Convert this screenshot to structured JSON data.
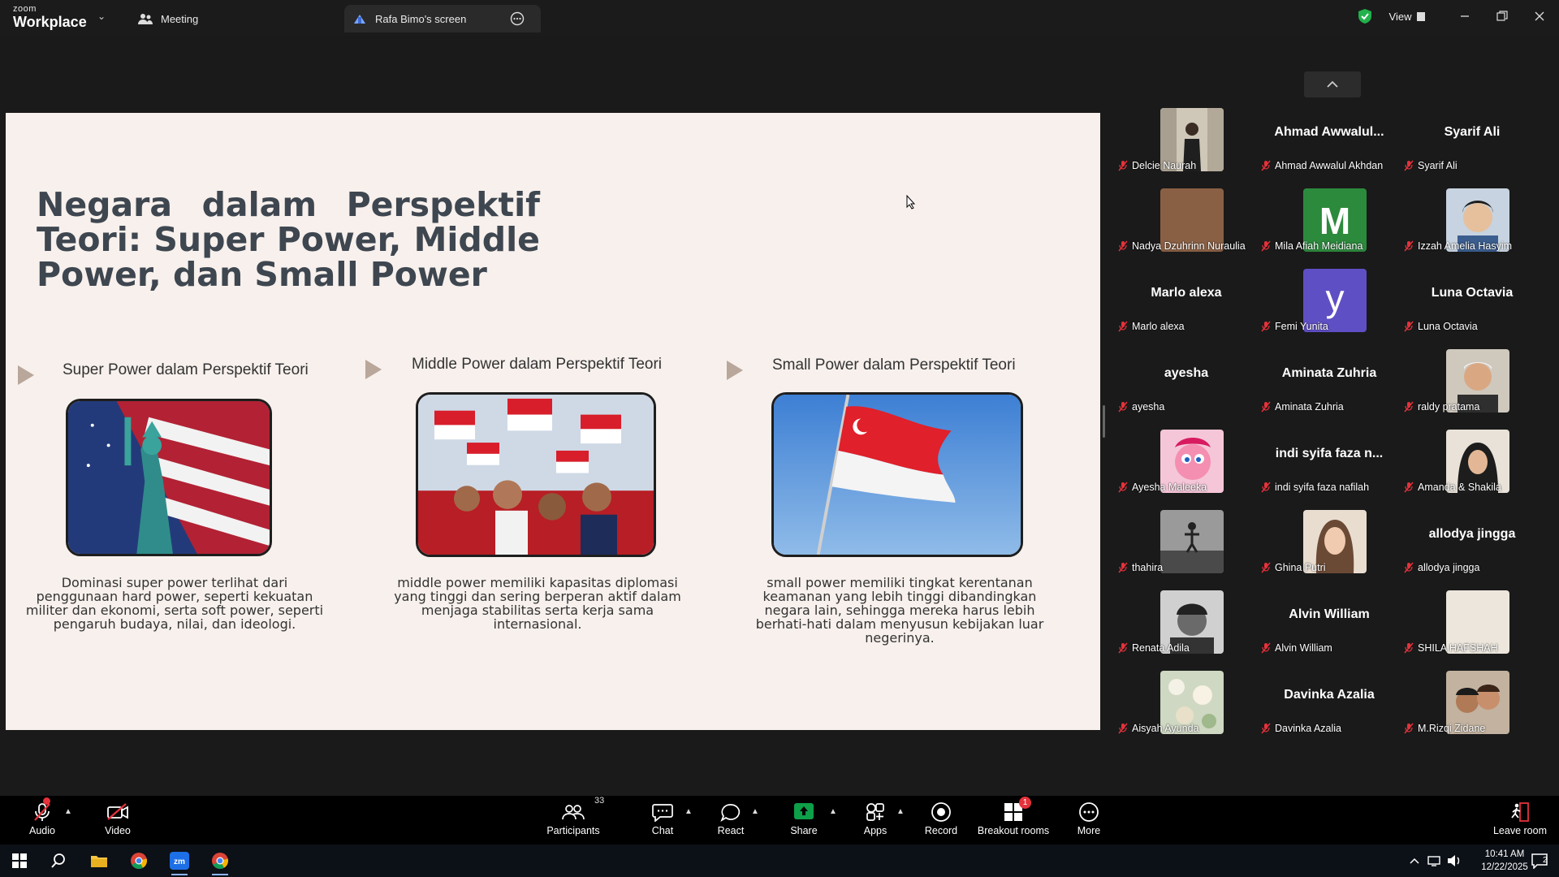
{
  "app": {
    "brand_small": "zoom",
    "brand_large": "Workplace"
  },
  "tabs": {
    "meeting": "Meeting",
    "screen": "Rafa Bimo's screen"
  },
  "view_label": "View",
  "slide": {
    "title": "Negara dalam Perspektif Teori: Super Power, Middle Power, dan Small Power",
    "columns": [
      {
        "heading": "Super Power dalam Perspektif Teori",
        "text": "Dominasi super power terlihat dari penggunaan hard power, seperti kekuatan militer dan ekonomi, serta soft power, seperti pengaruh budaya, nilai, dan ideologi."
      },
      {
        "heading": "Middle Power dalam Perspektif Teori",
        "text": "middle power memiliki kapasitas diplomasi yang tinggi dan sering berperan aktif dalam menjaga stabilitas serta kerja sama internasional."
      },
      {
        "heading": "Small Power dalam Perspektif Teori",
        "text": "small power memiliki tingkat kerentanan keamanan yang lebih tinggi dibandingkan negara lain, sehingga mereka harus lebih berhati-hati dalam menyusun kebijakan luar negerinya."
      }
    ]
  },
  "participants_gallery": [
    [
      {
        "name": "Delcie Naurah",
        "display": "",
        "avatar": "photo-suit"
      },
      {
        "name": "Ahmad Awwalul Akhdan",
        "display": "Ahmad Awwalul...",
        "avatar": ""
      },
      {
        "name": "Syarif Ali",
        "display": "Syarif Ali",
        "avatar": ""
      }
    ],
    [
      {
        "name": "Nadya Dzuhrinn Nuraulia",
        "display": "",
        "avatar": "brown-tile"
      },
      {
        "name": "Mila Afiah Meidiana",
        "display": "",
        "avatar": "letter-M"
      },
      {
        "name": "Izzah Amelia Hasyim",
        "display": "",
        "avatar": "photo-child"
      }
    ],
    [
      {
        "name": "Marlo alexa",
        "display": "Marlo alexa",
        "avatar": ""
      },
      {
        "name": "Femi Yunita",
        "display": "",
        "avatar": "letter-y"
      },
      {
        "name": "Luna Octavia",
        "display": "Luna Octavia",
        "avatar": ""
      }
    ],
    [
      {
        "name": "ayesha",
        "display": "ayesha",
        "avatar": ""
      },
      {
        "name": "Aminata Zuhria",
        "display": "Aminata Zuhria",
        "avatar": ""
      },
      {
        "name": "raldy pratama",
        "display": "",
        "avatar": "photo-man"
      }
    ],
    [
      {
        "name": "Ayesha Maleeka",
        "display": "",
        "avatar": "photo-pony"
      },
      {
        "name": "indi syifa faza nafilah",
        "display": "indi syifa faza n...",
        "avatar": ""
      },
      {
        "name": "Amanda & Shakila",
        "display": "",
        "avatar": "photo-hijab"
      }
    ],
    [
      {
        "name": "thahira",
        "display": "",
        "avatar": "photo-bw"
      },
      {
        "name": "Ghina Putri",
        "display": "",
        "avatar": "photo-girl"
      },
      {
        "name": "allodya jingga",
        "display": "allodya jingga",
        "avatar": ""
      }
    ],
    [
      {
        "name": "Renata Adila",
        "display": "",
        "avatar": "photo-bw2"
      },
      {
        "name": "Alvin William",
        "display": "Alvin William",
        "avatar": ""
      },
      {
        "name": "SHILA HAFSHAH",
        "display": "",
        "avatar": "beige-tile"
      }
    ],
    [
      {
        "name": "Aisyah Ayunda",
        "display": "",
        "avatar": "photo-flowers"
      },
      {
        "name": "Davinka Azalia",
        "display": "Davinka Azalia",
        "avatar": ""
      },
      {
        "name": "M.Rizqi Zidane",
        "display": "",
        "avatar": "photo-couple"
      }
    ]
  ],
  "toolbar": {
    "audio": "Audio",
    "video": "Video",
    "participants": "Participants",
    "participants_count": "33",
    "chat": "Chat",
    "react": "React",
    "share": "Share",
    "apps": "Apps",
    "record": "Record",
    "breakout": "Breakout rooms",
    "breakout_badge": "1",
    "more": "More",
    "leave": "Leave room"
  },
  "taskbar": {
    "time": "10:41 AM",
    "date": "12/22/2025",
    "notifications": "2"
  },
  "colors": {
    "toolbar_bg": "#000000",
    "share_green": "#0e9f49",
    "muted_red": "#e5323b",
    "slide_bg": "#f7f0ec"
  }
}
